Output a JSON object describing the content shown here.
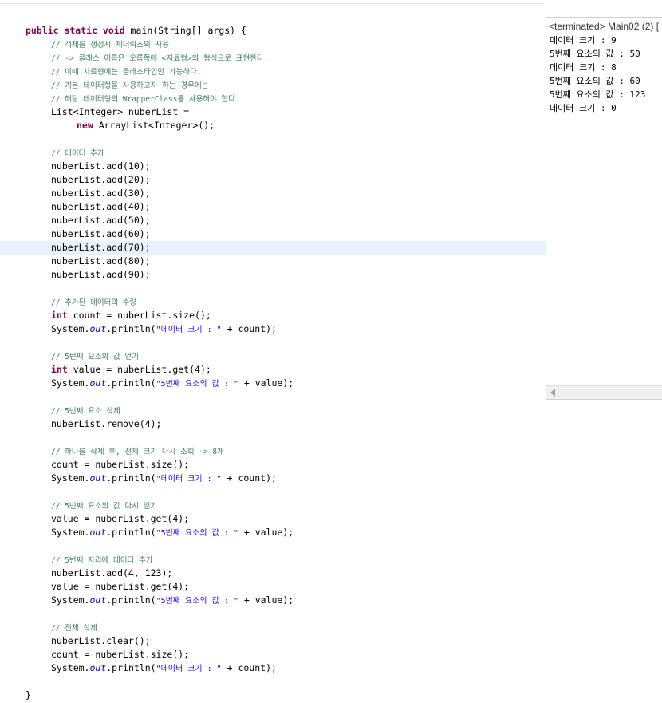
{
  "editor": {
    "lines": [
      {
        "segs": []
      },
      {
        "indent": 2,
        "segs": [
          {
            "t": "public static void",
            "c": "kw"
          },
          {
            "t": " main(String[] args) {"
          }
        ]
      },
      {
        "indent": 6,
        "segs": [
          {
            "t": "// 객체를 생성시 제너릭스의 사용",
            "c": "cm"
          }
        ]
      },
      {
        "indent": 6,
        "segs": [
          {
            "t": "// -> 클래스 이름은 오름쪽에 <자료형>의 형식으로 표현한다.",
            "c": "cm"
          }
        ]
      },
      {
        "indent": 6,
        "segs": [
          {
            "t": "// 이때 자료형에는 클래스타입만 가능하다.",
            "c": "cm"
          }
        ]
      },
      {
        "indent": 6,
        "segs": [
          {
            "t": "// 기본 데이터형을 사용하고자 하는 경우에는",
            "c": "cm"
          }
        ]
      },
      {
        "indent": 6,
        "segs": [
          {
            "t": "// 해당 데이터형의 WrapperClass를 사용해야 한다.",
            "c": "cm"
          }
        ]
      },
      {
        "indent": 6,
        "segs": [
          {
            "t": "List<Integer> nuberList ="
          }
        ]
      },
      {
        "indent": 10,
        "segs": [
          {
            "t": "new",
            "c": "kw"
          },
          {
            "t": " ArrayList<Integer>();"
          }
        ]
      },
      {
        "segs": []
      },
      {
        "indent": 6,
        "segs": [
          {
            "t": "// 데이터 추가",
            "c": "cm"
          }
        ]
      },
      {
        "indent": 6,
        "segs": [
          {
            "t": "nuberList.add(10);"
          }
        ]
      },
      {
        "indent": 6,
        "segs": [
          {
            "t": "nuberList.add(20);"
          }
        ]
      },
      {
        "indent": 6,
        "segs": [
          {
            "t": "nuberList.add(30);"
          }
        ]
      },
      {
        "indent": 6,
        "segs": [
          {
            "t": "nuberList.add(40);"
          }
        ]
      },
      {
        "indent": 6,
        "segs": [
          {
            "t": "nuberList.add(50);"
          }
        ]
      },
      {
        "indent": 6,
        "segs": [
          {
            "t": "nuberList.add(60);"
          }
        ]
      },
      {
        "indent": 6,
        "hl": true,
        "segs": [
          {
            "t": "nuberList.add(70);"
          }
        ]
      },
      {
        "indent": 6,
        "segs": [
          {
            "t": "nuberList.add(80);"
          }
        ]
      },
      {
        "indent": 6,
        "segs": [
          {
            "t": "nuberList.add(90);"
          }
        ]
      },
      {
        "segs": []
      },
      {
        "indent": 6,
        "segs": [
          {
            "t": "// 추가된 데이터의 수량",
            "c": "cm"
          }
        ]
      },
      {
        "indent": 6,
        "segs": [
          {
            "t": "int",
            "c": "kw"
          },
          {
            "t": " count = nuberList.size();"
          }
        ]
      },
      {
        "indent": 6,
        "segs": [
          {
            "t": "System."
          },
          {
            "t": "out",
            "c": "fld"
          },
          {
            "t": ".println("
          },
          {
            "t": "\"데이터 크기 : \"",
            "c": "st"
          },
          {
            "t": " + count);"
          }
        ]
      },
      {
        "segs": []
      },
      {
        "indent": 6,
        "segs": [
          {
            "t": "// 5번째 요소의 값 얻기",
            "c": "cm"
          }
        ]
      },
      {
        "indent": 6,
        "segs": [
          {
            "t": "int",
            "c": "kw"
          },
          {
            "t": " value = nuberList.get(4);"
          }
        ]
      },
      {
        "indent": 6,
        "segs": [
          {
            "t": "System."
          },
          {
            "t": "out",
            "c": "fld"
          },
          {
            "t": ".println("
          },
          {
            "t": "\"5번째 요소의 값 : \"",
            "c": "st"
          },
          {
            "t": " + value);"
          }
        ]
      },
      {
        "segs": []
      },
      {
        "indent": 6,
        "segs": [
          {
            "t": "// 5번째 요소 삭제",
            "c": "cm"
          }
        ]
      },
      {
        "indent": 6,
        "segs": [
          {
            "t": "nuberList.remove(4);"
          }
        ]
      },
      {
        "segs": []
      },
      {
        "indent": 6,
        "segs": [
          {
            "t": "// 하나를 삭제 후, 전체 크기 다시 조회 -> 8개",
            "c": "cm"
          }
        ]
      },
      {
        "indent": 6,
        "segs": [
          {
            "t": "count = nuberList.size();"
          }
        ]
      },
      {
        "indent": 6,
        "segs": [
          {
            "t": "System."
          },
          {
            "t": "out",
            "c": "fld"
          },
          {
            "t": ".println("
          },
          {
            "t": "\"데이터 크기 : \"",
            "c": "st"
          },
          {
            "t": " + count);"
          }
        ]
      },
      {
        "segs": []
      },
      {
        "indent": 6,
        "segs": [
          {
            "t": "// 5번째 요소의 값 다시 얻기",
            "c": "cm"
          }
        ]
      },
      {
        "indent": 6,
        "segs": [
          {
            "t": "value = nuberList.get(4);"
          }
        ]
      },
      {
        "indent": 6,
        "segs": [
          {
            "t": "System."
          },
          {
            "t": "out",
            "c": "fld"
          },
          {
            "t": ".println("
          },
          {
            "t": "\"5번째 요소의 값 : \"",
            "c": "st"
          },
          {
            "t": " + value);"
          }
        ]
      },
      {
        "segs": []
      },
      {
        "indent": 6,
        "segs": [
          {
            "t": "// 5번째 자리에 데이터 추가",
            "c": "cm"
          }
        ]
      },
      {
        "indent": 6,
        "segs": [
          {
            "t": "nuberList.add(4, 123);"
          }
        ]
      },
      {
        "indent": 6,
        "segs": [
          {
            "t": "value = nuberList.get(4);"
          }
        ]
      },
      {
        "indent": 6,
        "segs": [
          {
            "t": "System."
          },
          {
            "t": "out",
            "c": "fld"
          },
          {
            "t": ".println("
          },
          {
            "t": "\"5번째 요소의 값 : \"",
            "c": "st"
          },
          {
            "t": " + value);"
          }
        ]
      },
      {
        "segs": []
      },
      {
        "indent": 6,
        "segs": [
          {
            "t": "// 전체 삭제",
            "c": "cm"
          }
        ]
      },
      {
        "indent": 6,
        "segs": [
          {
            "t": "nuberList.clear();"
          }
        ]
      },
      {
        "indent": 6,
        "segs": [
          {
            "t": "count = nuberList.size();"
          }
        ]
      },
      {
        "indent": 6,
        "segs": [
          {
            "t": "System."
          },
          {
            "t": "out",
            "c": "fld"
          },
          {
            "t": ".println("
          },
          {
            "t": "\"데이터 크기 : \"",
            "c": "st"
          },
          {
            "t": " + count);"
          }
        ]
      },
      {
        "segs": []
      },
      {
        "indent": 2,
        "segs": [
          {
            "t": "}"
          }
        ]
      }
    ]
  },
  "console": {
    "header": "<terminated> Main02 (2) [",
    "lines": [
      "데이터 크기 : 9",
      "5번째 요소의 값 : 50",
      "데이터 크기 : 8",
      "5번째 요소의 값 : 60",
      "5번째 요소의 값 : 123",
      "데이터 크기 : 0"
    ]
  },
  "colors": {
    "keyword": "#7f0055",
    "comment": "#3f7f5f",
    "string": "#2a00ff",
    "field": "#0000c0",
    "highlight": "#e8f2fe"
  }
}
